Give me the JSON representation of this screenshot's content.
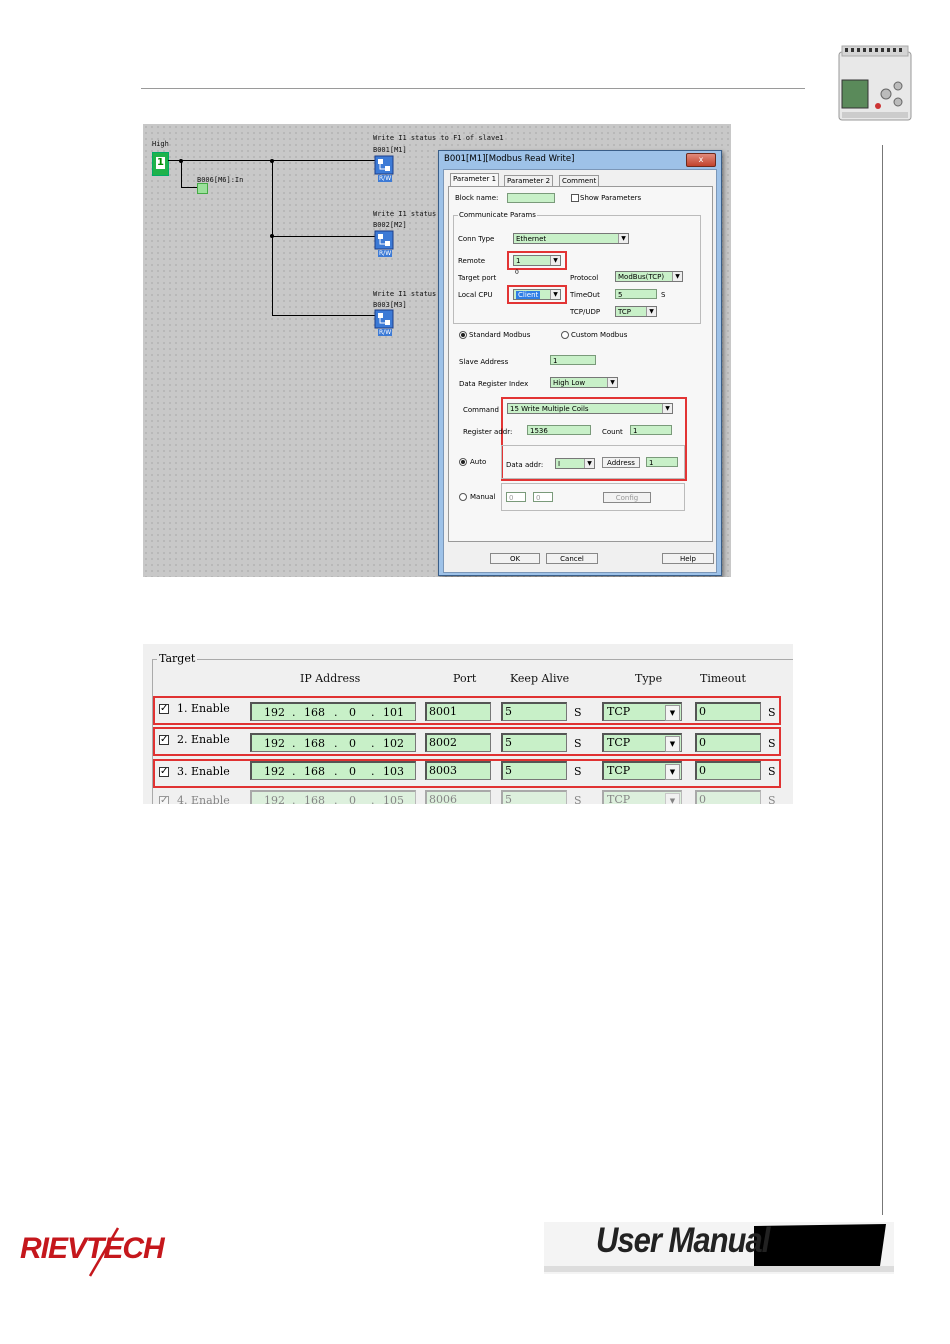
{
  "branding": {
    "logo_text": "RIEVTECH",
    "manual_label": "User Manual"
  },
  "ladder": {
    "contact_label": "High",
    "contact_value": "1",
    "input_block": "B006[M6]:In",
    "blocks": [
      {
        "comment": "Write I1 status to F1 of slave1",
        "id": "B001[M1]",
        "tag": "R/W"
      },
      {
        "comment": "Write I1 status",
        "id": "B002[M2]",
        "tag": "R/W"
      },
      {
        "comment": "Write I1 status",
        "id": "B003[M3]",
        "tag": "R/W"
      }
    ]
  },
  "dialog": {
    "title": "B001[M1][Modbus Read Write]",
    "close_label": "x",
    "tabs": [
      "Parameter 1",
      "Parameter 2",
      "Comment"
    ],
    "block_name_label": "Block name:",
    "show_params_label": "Show Parameters",
    "comm_group_label": "Communicate Params",
    "conn_type_label": "Conn Type",
    "conn_type_value": "Ethernet",
    "remote_label": "Remote",
    "remote_value": "1",
    "target_port_label": "Target port",
    "target_port_value": "0",
    "protocol_label": "Protocol",
    "protocol_value": "ModBus(TCP)",
    "local_cpu_label": "Local CPU",
    "local_cpu_value": "Client",
    "timeout_label": "TimeOut",
    "timeout_value": "5",
    "timeout_unit": "S",
    "tcpudp_label": "TCP/UDP",
    "tcpudp_value": "TCP",
    "std_modbus_label": "Standard Modbus",
    "custom_modbus_label": "Custom Modbus",
    "slave_addr_label": "Slave Address",
    "slave_addr_value": "1",
    "reg_index_label": "Data Register Index",
    "reg_index_value": "High Low",
    "command_label": "Command",
    "command_value": "15 Write Multiple Coils",
    "register_addr_label": "Register addr:",
    "register_addr_value": "1536",
    "count_label": "Count",
    "count_value": "1",
    "auto_label": "Auto",
    "data_addr_label": "Data addr:",
    "data_addr_value": "I",
    "address_button": "Address",
    "address_value": "1",
    "manual_label": "Manual",
    "manual_v1": "0",
    "manual_v2": "0",
    "config_button": "Config",
    "ok_button": "OK",
    "cancel_button": "Cancel",
    "help_button": "Help"
  },
  "target": {
    "legend": "Target",
    "headers": {
      "ip": "IP Address",
      "port": "Port",
      "keepalive": "Keep Alive",
      "type": "Type",
      "timeout": "Timeout"
    },
    "rows": [
      {
        "enable": "1. Enable",
        "ip": [
          "192",
          "168",
          "0",
          "101"
        ],
        "port": "8001",
        "keepalive": "5",
        "ka_unit": "S",
        "type": "TCP",
        "timeout": "0",
        "to_unit": "S"
      },
      {
        "enable": "2. Enable",
        "ip": [
          "192",
          "168",
          "0",
          "102"
        ],
        "port": "8002",
        "keepalive": "5",
        "ka_unit": "S",
        "type": "TCP",
        "timeout": "0",
        "to_unit": "S"
      },
      {
        "enable": "3. Enable",
        "ip": [
          "192",
          "168",
          "0",
          "103"
        ],
        "port": "8003",
        "keepalive": "5",
        "ka_unit": "S",
        "type": "TCP",
        "timeout": "0",
        "to_unit": "S"
      },
      {
        "enable": "4. Enable",
        "ip": [
          "192",
          "168",
          "0",
          "105"
        ],
        "port": "8006",
        "keepalive": "5",
        "ka_unit": "S",
        "type": "TCP",
        "timeout": "0",
        "to_unit": "S"
      }
    ]
  },
  "colors": {
    "field_green": "#c8f0c8",
    "highlight_red": "#e23434",
    "brand_red": "#c5171c"
  }
}
